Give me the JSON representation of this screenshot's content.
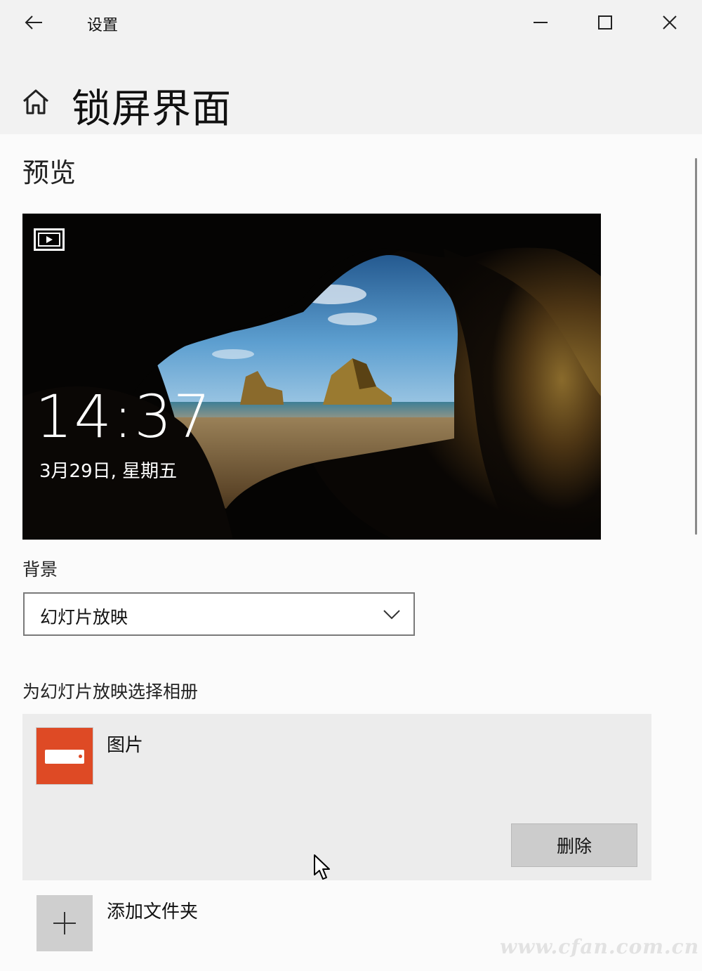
{
  "window": {
    "title": "设置",
    "back_icon": "arrow-left-icon",
    "minimize_icon": "minimize-icon",
    "maximize_icon": "maximize-icon",
    "close_icon": "close-icon"
  },
  "header": {
    "home_icon": "home-icon",
    "title": "锁屏界面"
  },
  "preview": {
    "section_title": "预览",
    "time": "14:37",
    "date": "3月29日, 星期五",
    "slideshow_icon": "slideshow-icon"
  },
  "background": {
    "label": "背景",
    "selected": "幻灯片放映",
    "chevron_icon": "chevron-down-icon"
  },
  "album": {
    "label": "为幻灯片放映选择相册",
    "items": [
      {
        "name": "图片",
        "delete_label": "删除",
        "thumb_color": "#de4a25"
      }
    ],
    "add_label": "添加文件夹",
    "add_icon": "plus-icon"
  },
  "watermark": "www.cfan.com.cn"
}
